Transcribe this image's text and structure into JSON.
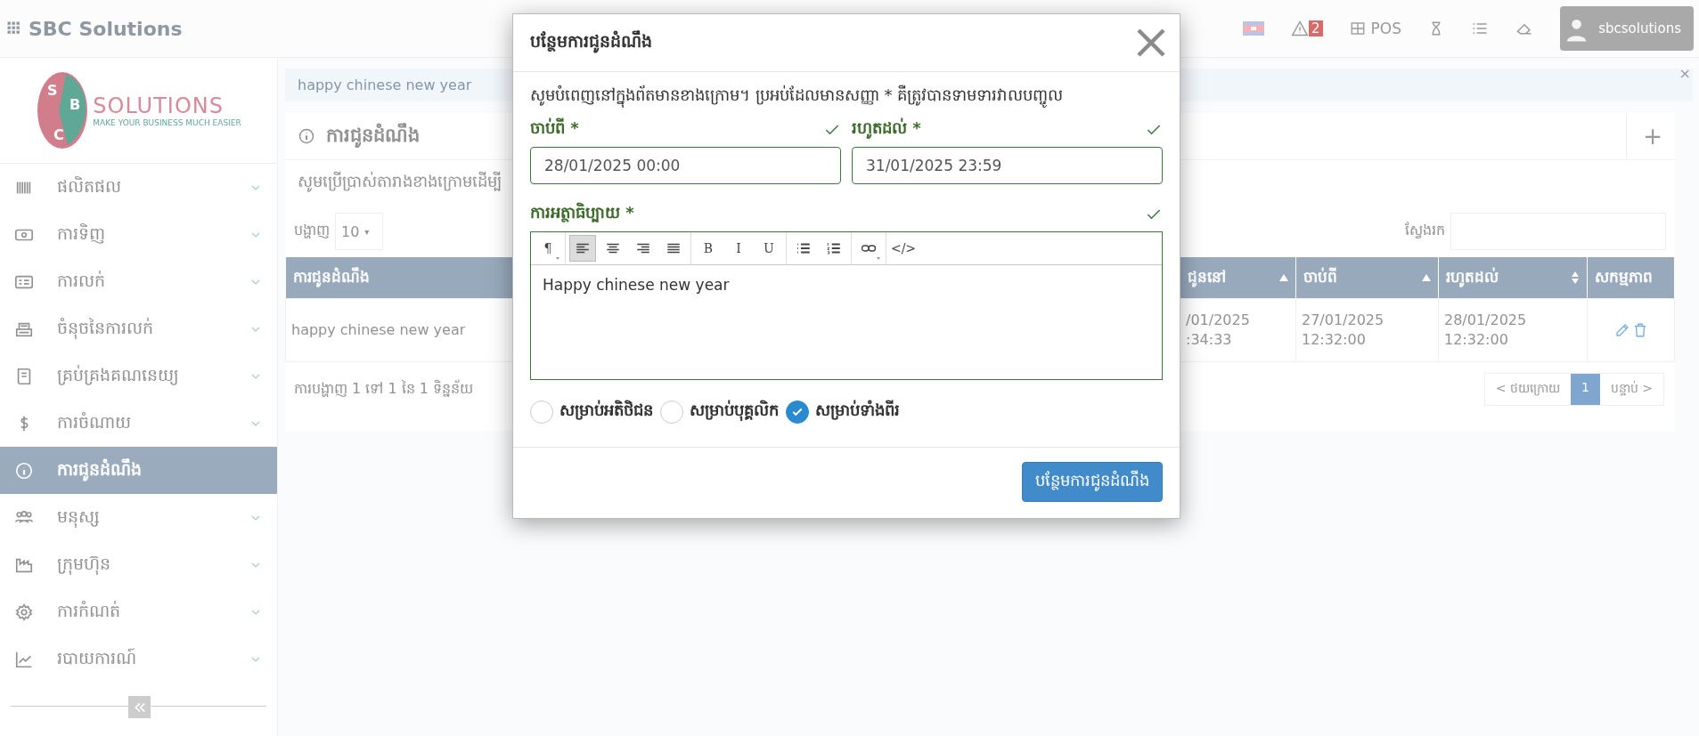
{
  "topbar": {
    "brand": "SBC Solutions",
    "alert_count": "2",
    "pos_label": "POS",
    "user": "sbcsolutions"
  },
  "logo": {
    "letters": [
      "S",
      "B",
      "C"
    ],
    "name": "SOLUTIONS",
    "tagline": "MAKE YOUR BUSINESS MUCH EASIER"
  },
  "sidebar": {
    "items": [
      {
        "label": "ផលិតផល",
        "selected": false,
        "expandable": true
      },
      {
        "label": "ការទិញ",
        "selected": false,
        "expandable": true
      },
      {
        "label": "ការលក់",
        "selected": false,
        "expandable": true
      },
      {
        "label": "ចំនុចនៃការលក់",
        "selected": false,
        "expandable": true
      },
      {
        "label": "គ្រប់គ្រងគណនេយ្យ",
        "selected": false,
        "expandable": true
      },
      {
        "label": "ការចំណាយ",
        "selected": false,
        "expandable": true
      },
      {
        "label": "ការជូនដំណឹង",
        "selected": true,
        "expandable": false
      },
      {
        "label": "មនុស្ស",
        "selected": false,
        "expandable": true
      },
      {
        "label": "ក្រុមហ៊ុន",
        "selected": false,
        "expandable": true
      },
      {
        "label": "ការកំណត់",
        "selected": false,
        "expandable": true
      },
      {
        "label": "របាយការណ៍",
        "selected": false,
        "expandable": true
      }
    ]
  },
  "alert": {
    "text": "happy chinese new year",
    "close": "×"
  },
  "card": {
    "title": "ការជូនដំណឹង",
    "add": "+",
    "subtitle": "សូមប្រើប្រាស់តារាងខាងក្រោមដើម្បី",
    "length_label": "បង្ហាញ",
    "length_value": "10",
    "length_caret": "▾",
    "search_label": "ស្វែងរក"
  },
  "table": {
    "columns": [
      {
        "label": "ការជូនដំណឹង"
      },
      {
        "label": "ជូននៅ",
        "sortable": true,
        "sorted_ascending": true
      },
      {
        "label": "ចាប់ពី",
        "sortable": true,
        "sorted_ascending": true
      },
      {
        "label": "រហូតដល់",
        "sortable": true,
        "sorted_ascending": false
      },
      {
        "label": "សកម្មភាព",
        "sortable": false
      }
    ],
    "rows": [
      {
        "cells": [
          [
            "happy chinese new year"
          ],
          [
            "/01/2025",
            ":34:33"
          ],
          [
            "27/01/2025",
            "12:32:00"
          ],
          [
            "28/01/2025",
            "12:32:00"
          ]
        ]
      }
    ]
  },
  "footer": {
    "info": "ការបង្ហាញ 1 ទៅ 1 នៃ 1 ទិន្នន័យ",
    "pages": [
      {
        "label": "< ថយក្រោយ",
        "selected": false
      },
      {
        "label": "1",
        "selected": true
      },
      {
        "label": "បន្ទាប់ >",
        "selected": false
      }
    ]
  },
  "modal": {
    "title": "បន្ថែមការជូនដំណឹង",
    "intro": "សូមបំពេញនៅក្នុងព័តមានខាងក្រោម។ ប្រអប់ដែលមានសញ្ញា * គឺត្រូវបានទាមទារវាលបញ្ចូល",
    "fields": [
      {
        "label": "ចាប់ពី *",
        "value": "28/01/2025 00:00",
        "valid": true
      },
      {
        "label": "រហូតដល់ *",
        "value": "31/01/2025 23:59",
        "valid": true
      }
    ],
    "editor": {
      "label": "ការអត្ថាធិប្បាយ *",
      "valid": true,
      "value": "Happy chinese new year",
      "toolbar": [
        {
          "tools": [
            {
              "kind": "text",
              "label": "¶",
              "selected": false,
              "dropdown": true
            }
          ]
        },
        {
          "tools": [
            {
              "kind": "align-left",
              "selected": true,
              "dropdown": false
            },
            {
              "kind": "align-center",
              "selected": false,
              "dropdown": false
            },
            {
              "kind": "align-right",
              "selected": false,
              "dropdown": false
            },
            {
              "kind": "justify",
              "selected": false,
              "dropdown": false
            }
          ]
        },
        {
          "tools": [
            {
              "kind": "text",
              "label": "B",
              "selected": false,
              "dropdown": false
            },
            {
              "kind": "text",
              "label": "I",
              "selected": false,
              "dropdown": false
            },
            {
              "kind": "text",
              "label": "U",
              "selected": false,
              "dropdown": false
            }
          ]
        },
        {
          "tools": [
            {
              "kind": "bullets",
              "selected": false,
              "dropdown": false
            },
            {
              "kind": "numbers",
              "selected": false,
              "dropdown": false
            }
          ]
        },
        {
          "tools": [
            {
              "kind": "link",
              "selected": false,
              "dropdown": true
            }
          ]
        },
        {
          "tools": [
            {
              "kind": "text",
              "label": "</>",
              "selected": false,
              "dropdown": false
            }
          ]
        }
      ]
    },
    "audience": [
      {
        "label": "សម្រាប់អតិថិជន",
        "selected": false
      },
      {
        "label": "សម្រាប់បុគ្គលិក",
        "selected": false
      },
      {
        "label": "សម្រាប់ទាំងពីរ",
        "selected": true
      }
    ],
    "submit": "បន្ថែមការជូនដំណឹង"
  }
}
